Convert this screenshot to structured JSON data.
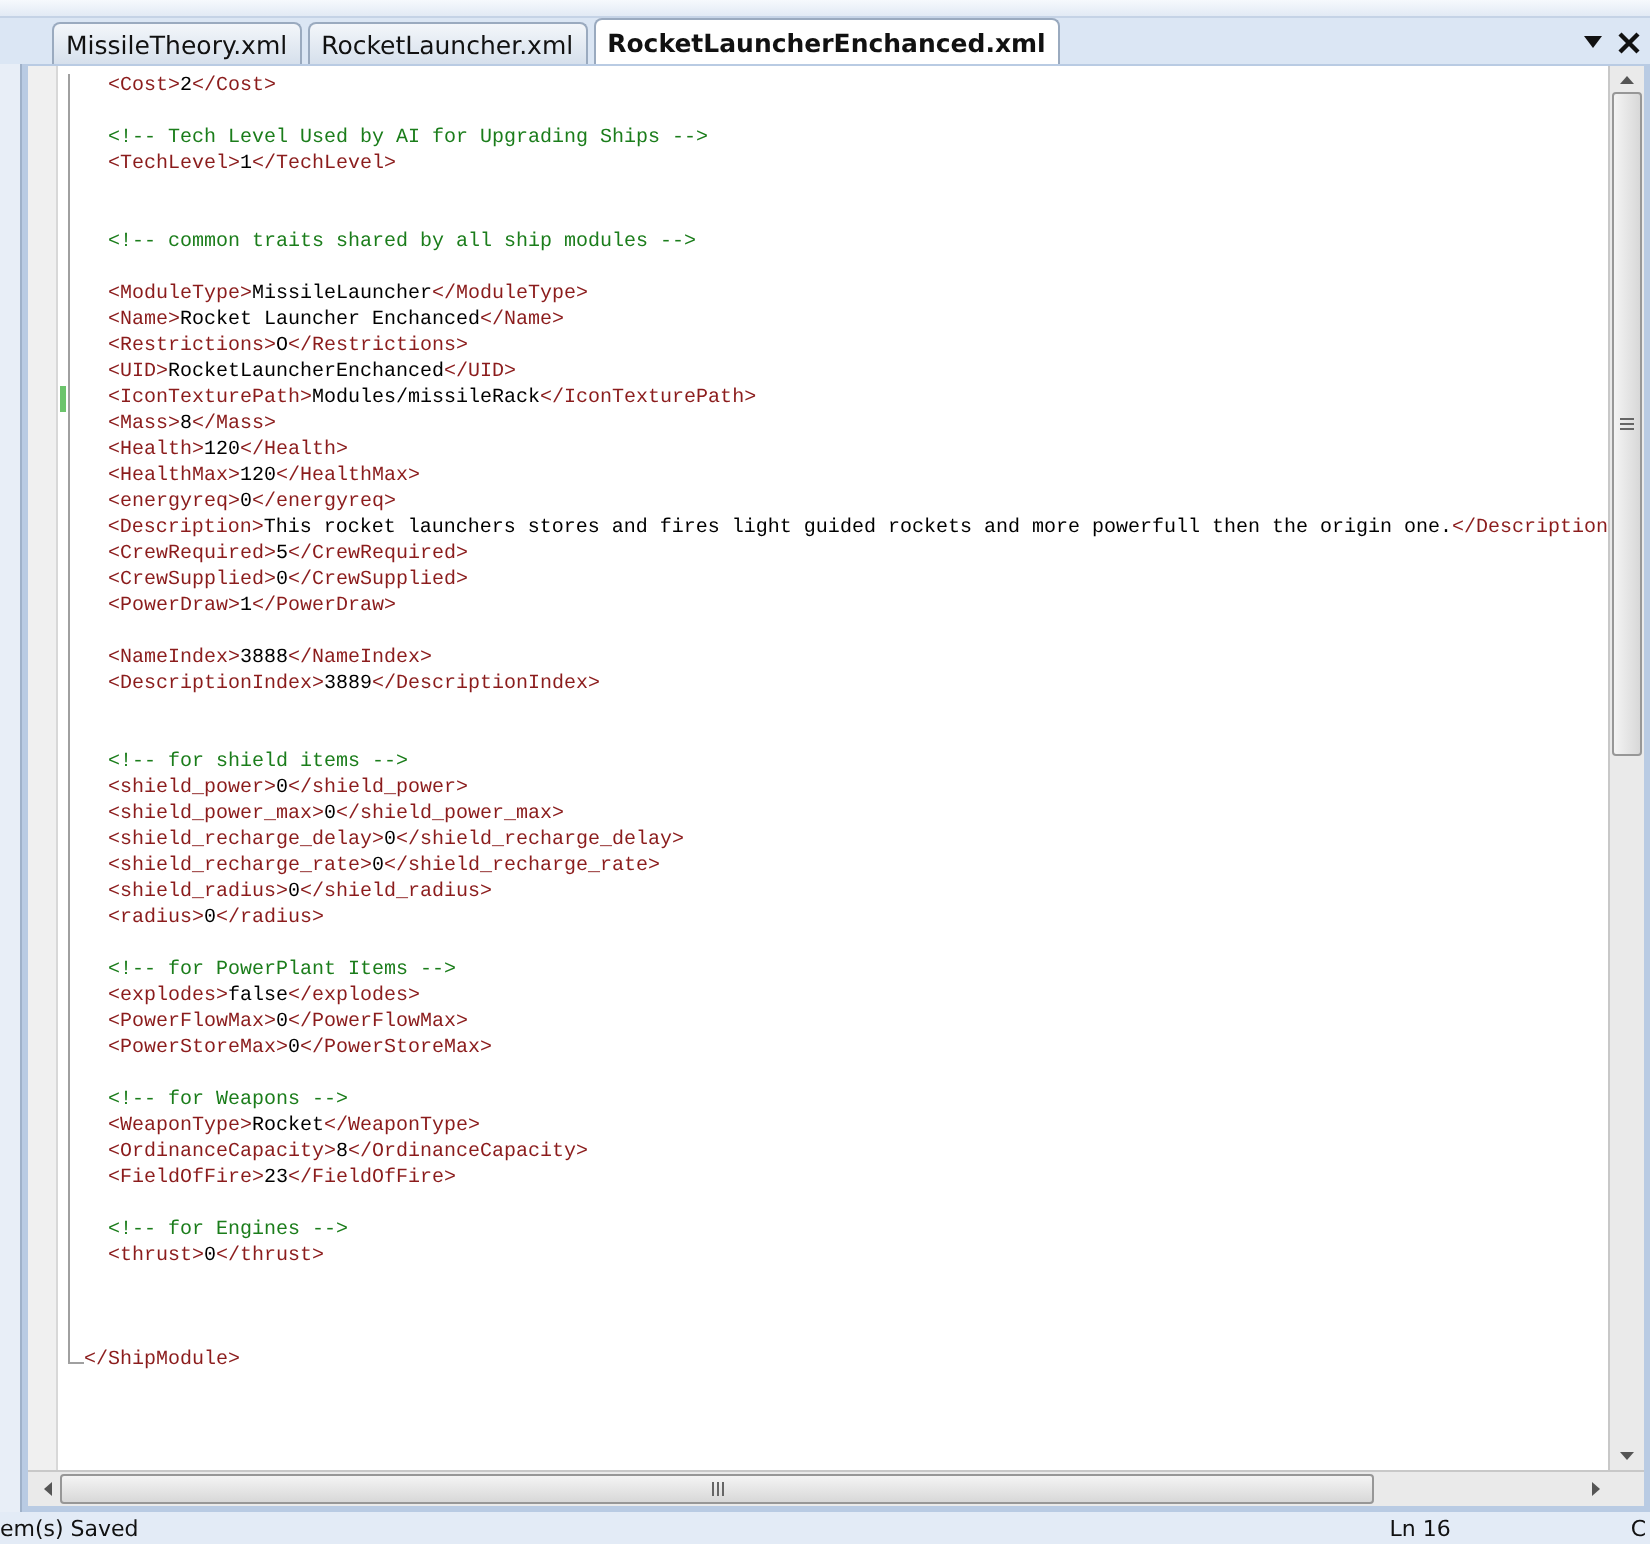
{
  "tabs": [
    {
      "label": "MissileTheory.xml",
      "selected": false
    },
    {
      "label": "RocketLauncher.xml",
      "selected": false
    },
    {
      "label": "RocketLauncherEnchanced.xml",
      "selected": true
    }
  ],
  "editor": {
    "lines": [
      {
        "kind": "code",
        "changed": false,
        "segments": [
          {
            "kind": "tag",
            "text": "<Cost>"
          },
          {
            "kind": "text",
            "text": "2"
          },
          {
            "kind": "tag",
            "text": "</Cost>"
          }
        ]
      },
      {
        "kind": "blank"
      },
      {
        "kind": "code",
        "changed": false,
        "segments": [
          {
            "kind": "comment",
            "text": "<!-- Tech Level Used by AI for Upgrading Ships -->"
          }
        ]
      },
      {
        "kind": "code",
        "changed": false,
        "segments": [
          {
            "kind": "tag",
            "text": "<TechLevel>"
          },
          {
            "kind": "text",
            "text": "1"
          },
          {
            "kind": "tag",
            "text": "</TechLevel>"
          }
        ]
      },
      {
        "kind": "blank"
      },
      {
        "kind": "blank"
      },
      {
        "kind": "code",
        "changed": false,
        "segments": [
          {
            "kind": "comment",
            "text": "<!-- common traits shared by all ship modules -->"
          }
        ]
      },
      {
        "kind": "blank"
      },
      {
        "kind": "code",
        "changed": false,
        "segments": [
          {
            "kind": "tag",
            "text": "<ModuleType>"
          },
          {
            "kind": "text",
            "text": "MissileLauncher"
          },
          {
            "kind": "tag",
            "text": "</ModuleType>"
          }
        ]
      },
      {
        "kind": "code",
        "changed": false,
        "segments": [
          {
            "kind": "tag",
            "text": "<Name>"
          },
          {
            "kind": "text",
            "text": "Rocket Launcher Enchanced"
          },
          {
            "kind": "tag",
            "text": "</Name>"
          }
        ]
      },
      {
        "kind": "code",
        "changed": false,
        "segments": [
          {
            "kind": "tag",
            "text": "<Restrictions>"
          },
          {
            "kind": "text",
            "text": "O"
          },
          {
            "kind": "tag",
            "text": "</Restrictions>"
          }
        ]
      },
      {
        "kind": "code",
        "changed": false,
        "segments": [
          {
            "kind": "tag",
            "text": "<UID>"
          },
          {
            "kind": "text",
            "text": "RocketLauncherEnchanced"
          },
          {
            "kind": "tag",
            "text": "</UID>"
          }
        ]
      },
      {
        "kind": "code",
        "changed": true,
        "segments": [
          {
            "kind": "tag",
            "text": "<IconTexturePath>"
          },
          {
            "kind": "text",
            "text": "Modules/missileRack"
          },
          {
            "kind": "tag",
            "text": "</IconTexturePath>"
          }
        ]
      },
      {
        "kind": "code",
        "changed": false,
        "segments": [
          {
            "kind": "tag",
            "text": "<Mass>"
          },
          {
            "kind": "text",
            "text": "8"
          },
          {
            "kind": "tag",
            "text": "</Mass>"
          }
        ]
      },
      {
        "kind": "code",
        "changed": false,
        "segments": [
          {
            "kind": "tag",
            "text": "<Health>"
          },
          {
            "kind": "text",
            "text": "120"
          },
          {
            "kind": "tag",
            "text": "</Health>"
          }
        ]
      },
      {
        "kind": "code",
        "changed": false,
        "segments": [
          {
            "kind": "tag",
            "text": "<HealthMax>"
          },
          {
            "kind": "text",
            "text": "120"
          },
          {
            "kind": "tag",
            "text": "</HealthMax>"
          }
        ]
      },
      {
        "kind": "code",
        "changed": false,
        "segments": [
          {
            "kind": "tag",
            "text": "<energyreq>"
          },
          {
            "kind": "text",
            "text": "0"
          },
          {
            "kind": "tag",
            "text": "</energyreq>"
          }
        ]
      },
      {
        "kind": "code",
        "changed": false,
        "segments": [
          {
            "kind": "tag",
            "text": "<Description>"
          },
          {
            "kind": "text",
            "text": "This rocket launchers stores and fires light guided rockets and more powerfull then the origin one."
          },
          {
            "kind": "tag",
            "text": "</Description"
          }
        ]
      },
      {
        "kind": "code",
        "changed": false,
        "segments": [
          {
            "kind": "tag",
            "text": "<CrewRequired>"
          },
          {
            "kind": "text",
            "text": "5"
          },
          {
            "kind": "tag",
            "text": "</CrewRequired>"
          }
        ]
      },
      {
        "kind": "code",
        "changed": false,
        "segments": [
          {
            "kind": "tag",
            "text": "<CrewSupplied>"
          },
          {
            "kind": "text",
            "text": "0"
          },
          {
            "kind": "tag",
            "text": "</CrewSupplied>"
          }
        ]
      },
      {
        "kind": "code",
        "changed": false,
        "segments": [
          {
            "kind": "tag",
            "text": "<PowerDraw>"
          },
          {
            "kind": "text",
            "text": "1"
          },
          {
            "kind": "tag",
            "text": "</PowerDraw>"
          }
        ]
      },
      {
        "kind": "blank"
      },
      {
        "kind": "code",
        "changed": false,
        "segments": [
          {
            "kind": "tag",
            "text": "<NameIndex>"
          },
          {
            "kind": "text",
            "text": "3888"
          },
          {
            "kind": "tag",
            "text": "</NameIndex>"
          }
        ]
      },
      {
        "kind": "code",
        "changed": false,
        "segments": [
          {
            "kind": "tag",
            "text": "<DescriptionIndex>"
          },
          {
            "kind": "text",
            "text": "3889"
          },
          {
            "kind": "tag",
            "text": "</DescriptionIndex>"
          }
        ]
      },
      {
        "kind": "blank"
      },
      {
        "kind": "blank"
      },
      {
        "kind": "code",
        "changed": false,
        "segments": [
          {
            "kind": "comment",
            "text": "<!-- for shield items -->"
          }
        ]
      },
      {
        "kind": "code",
        "changed": false,
        "segments": [
          {
            "kind": "tag",
            "text": "<shield_power>"
          },
          {
            "kind": "text",
            "text": "0"
          },
          {
            "kind": "tag",
            "text": "</shield_power>"
          }
        ]
      },
      {
        "kind": "code",
        "changed": false,
        "segments": [
          {
            "kind": "tag",
            "text": "<shield_power_max>"
          },
          {
            "kind": "text",
            "text": "0"
          },
          {
            "kind": "tag",
            "text": "</shield_power_max>"
          }
        ]
      },
      {
        "kind": "code",
        "changed": false,
        "segments": [
          {
            "kind": "tag",
            "text": "<shield_recharge_delay>"
          },
          {
            "kind": "text",
            "text": "0"
          },
          {
            "kind": "tag",
            "text": "</shield_recharge_delay>"
          }
        ]
      },
      {
        "kind": "code",
        "changed": false,
        "segments": [
          {
            "kind": "tag",
            "text": "<shield_recharge_rate>"
          },
          {
            "kind": "text",
            "text": "0"
          },
          {
            "kind": "tag",
            "text": "</shield_recharge_rate>"
          }
        ]
      },
      {
        "kind": "code",
        "changed": false,
        "segments": [
          {
            "kind": "tag",
            "text": "<shield_radius>"
          },
          {
            "kind": "text",
            "text": "0"
          },
          {
            "kind": "tag",
            "text": "</shield_radius>"
          }
        ]
      },
      {
        "kind": "code",
        "changed": false,
        "segments": [
          {
            "kind": "tag",
            "text": "<radius>"
          },
          {
            "kind": "text",
            "text": "0"
          },
          {
            "kind": "tag",
            "text": "</radius>"
          }
        ]
      },
      {
        "kind": "blank"
      },
      {
        "kind": "code",
        "changed": false,
        "segments": [
          {
            "kind": "comment",
            "text": "<!-- for PowerPlant Items -->"
          }
        ]
      },
      {
        "kind": "code",
        "changed": false,
        "segments": [
          {
            "kind": "tag",
            "text": "<explodes>"
          },
          {
            "kind": "text",
            "text": "false"
          },
          {
            "kind": "tag",
            "text": "</explodes>"
          }
        ]
      },
      {
        "kind": "code",
        "changed": false,
        "segments": [
          {
            "kind": "tag",
            "text": "<PowerFlowMax>"
          },
          {
            "kind": "text",
            "text": "0"
          },
          {
            "kind": "tag",
            "text": "</PowerFlowMax>"
          }
        ]
      },
      {
        "kind": "code",
        "changed": false,
        "segments": [
          {
            "kind": "tag",
            "text": "<PowerStoreMax>"
          },
          {
            "kind": "text",
            "text": "0"
          },
          {
            "kind": "tag",
            "text": "</PowerStoreMax>"
          }
        ]
      },
      {
        "kind": "blank"
      },
      {
        "kind": "code",
        "changed": false,
        "segments": [
          {
            "kind": "comment",
            "text": "<!-- for Weapons -->"
          }
        ]
      },
      {
        "kind": "code",
        "changed": false,
        "segments": [
          {
            "kind": "tag",
            "text": "<WeaponType>"
          },
          {
            "kind": "text",
            "text": "Rocket"
          },
          {
            "kind": "tag",
            "text": "</WeaponType>"
          }
        ]
      },
      {
        "kind": "code",
        "changed": false,
        "segments": [
          {
            "kind": "tag",
            "text": "<OrdinanceCapacity>"
          },
          {
            "kind": "text",
            "text": "8"
          },
          {
            "kind": "tag",
            "text": "</OrdinanceCapacity>"
          }
        ]
      },
      {
        "kind": "code",
        "changed": false,
        "segments": [
          {
            "kind": "tag",
            "text": "<FieldOfFire>"
          },
          {
            "kind": "text",
            "text": "23"
          },
          {
            "kind": "tag",
            "text": "</FieldOfFire>"
          }
        ]
      },
      {
        "kind": "blank"
      },
      {
        "kind": "code",
        "changed": false,
        "segments": [
          {
            "kind": "comment",
            "text": "<!-- for Engines -->"
          }
        ]
      },
      {
        "kind": "code",
        "changed": false,
        "segments": [
          {
            "kind": "tag",
            "text": "<thrust>"
          },
          {
            "kind": "text",
            "text": "0"
          },
          {
            "kind": "tag",
            "text": "</thrust>"
          }
        ]
      },
      {
        "kind": "blank"
      },
      {
        "kind": "blank"
      },
      {
        "kind": "blank"
      },
      {
        "kind": "root",
        "changed": false,
        "segments": [
          {
            "kind": "tag",
            "text": "</ShipModule>"
          }
        ]
      }
    ]
  },
  "status_bar": {
    "message": "em(s) Saved",
    "line": "Ln 16",
    "column": "C"
  }
}
